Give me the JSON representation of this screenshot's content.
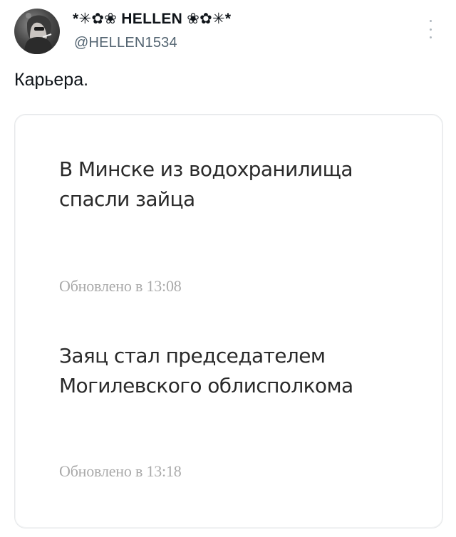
{
  "tweet": {
    "display_name": "*✳︎✿❀ HELLEN ❀✿✳︎*",
    "handle": "@HELLEN1534",
    "text": "Карьера.",
    "avatar_icon": "woman-with-cigarette-avatar",
    "more_icon": "vertical-dots-icon"
  },
  "media": {
    "news": [
      {
        "title_line1": "В Минске из водохранилища",
        "title_line2": "спасли зайца",
        "updated": "Обновлено в 13:08"
      },
      {
        "title_line1": "Заяц стал председателем",
        "title_line2": "Могилевского облисполкома",
        "updated": "Обновлено в 13:18"
      }
    ]
  },
  "colors": {
    "text_primary": "#0f1419",
    "text_secondary": "#536471",
    "news_title": "#2a2a2a",
    "news_time": "#a9a9a9",
    "card_border": "#e6e8ea"
  }
}
